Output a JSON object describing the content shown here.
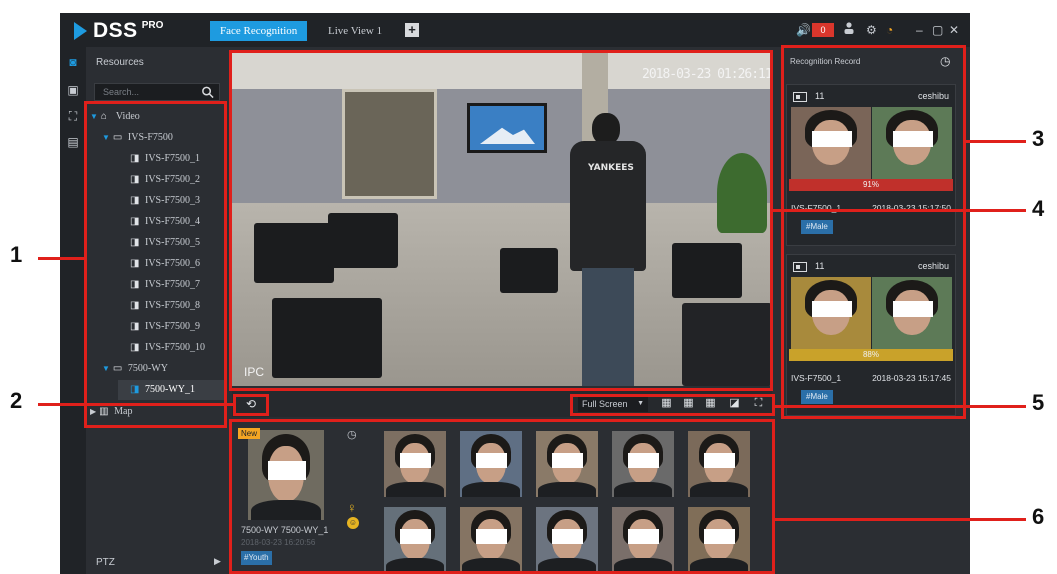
{
  "app": {
    "logo_text": "DSS",
    "logo_sup": "PRO",
    "tabs": [
      {
        "label": "Face Recognition",
        "active": true
      },
      {
        "label": "Live View 1",
        "active": false
      }
    ],
    "alarm_count": "0",
    "accent_color": "#1e9be0"
  },
  "resources": {
    "title": "Resources",
    "search_placeholder": "Search...",
    "tree": [
      {
        "label": "Video",
        "level": 0,
        "icon": "tower-icon",
        "expanded": true
      },
      {
        "label": "IVS-F7500",
        "level": 1,
        "icon": "nvr-icon",
        "expanded": true
      },
      {
        "label": "IVS-F7500_1",
        "level": 2,
        "icon": "camera-icon"
      },
      {
        "label": "IVS-F7500_2",
        "level": 2,
        "icon": "camera-icon"
      },
      {
        "label": "IVS-F7500_3",
        "level": 2,
        "icon": "camera-icon"
      },
      {
        "label": "IVS-F7500_4",
        "level": 2,
        "icon": "camera-icon"
      },
      {
        "label": "IVS-F7500_5",
        "level": 2,
        "icon": "camera-icon"
      },
      {
        "label": "IVS-F7500_6",
        "level": 2,
        "icon": "camera-icon"
      },
      {
        "label": "IVS-F7500_7",
        "level": 2,
        "icon": "camera-icon"
      },
      {
        "label": "IVS-F7500_8",
        "level": 2,
        "icon": "camera-icon"
      },
      {
        "label": "IVS-F7500_9",
        "level": 2,
        "icon": "camera-icon"
      },
      {
        "label": "IVS-F7500_10",
        "level": 2,
        "icon": "camera-icon"
      },
      {
        "label": "7500-WY",
        "level": 1,
        "icon": "nvr-icon",
        "expanded": true
      },
      {
        "label": "7500-WY_1",
        "level": 2,
        "icon": "camera-icon",
        "selected": true
      },
      {
        "label": "Map",
        "level": 0,
        "icon": "map-icon",
        "expanded": false
      }
    ],
    "ptz_label": "PTZ"
  },
  "video": {
    "timestamp": "2018-03-23 01:26:11",
    "jacket_text": "YANKEES",
    "channel_label": "IPC"
  },
  "video_toolbar": {
    "split_mode": "Full Screen"
  },
  "capture": {
    "new_badge": "New",
    "name": "7500-WY 7500-WY_1",
    "time": "2018-03-23 16:20:56",
    "tag": "#Youth",
    "thumbs_count": 10
  },
  "record": {
    "title": "Recognition Record",
    "cards": [
      {
        "id": "11",
        "library": "ceshibu",
        "similarity": "91%",
        "device": "IVS-F7500_1",
        "time": "2018-03-23 15:17:50",
        "tag": "#Male",
        "sim_color": "#c0302b"
      },
      {
        "id": "11",
        "library": "ceshibu",
        "similarity": "88%",
        "device": "IVS-F7500_1",
        "time": "2018-03-23 15:17:45",
        "tag": "#Male",
        "sim_color": "#c9a22a"
      }
    ]
  },
  "callouts": [
    "1",
    "2",
    "3",
    "4",
    "5",
    "6"
  ]
}
